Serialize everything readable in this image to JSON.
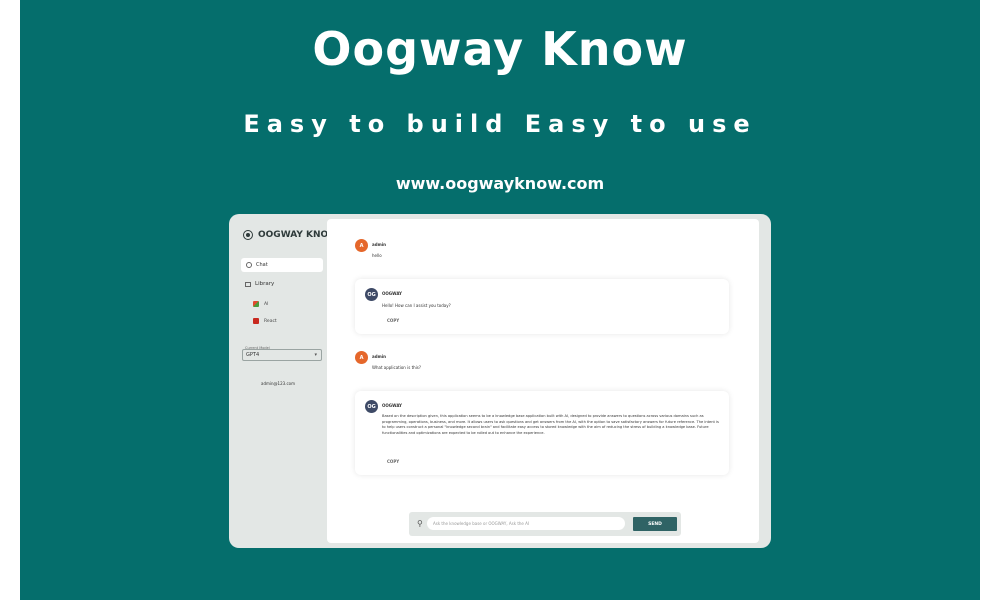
{
  "hero": {
    "title": "Oogway Know",
    "tagline": "Easy to build Easy to use",
    "url": "www.oogwayknow.com"
  },
  "app": {
    "sidebar": {
      "brand": "OOGWAY KNOW",
      "nav_chat": "Chat",
      "nav_library": "Library",
      "library_items": [
        "AI",
        "React"
      ],
      "model_label": "Current Model",
      "model_value": "GPT4",
      "user_email": "admin@123.com"
    },
    "chat": {
      "messages": [
        {
          "role": "user",
          "avatar": "A",
          "sender": "admin",
          "text": "hello"
        },
        {
          "role": "bot",
          "avatar": "OG",
          "sender": "OOGWAY",
          "text": "Hello! How can I assist you today?",
          "copy": "COPY"
        },
        {
          "role": "user",
          "avatar": "A",
          "sender": "admin",
          "text": "What application is this?"
        },
        {
          "role": "bot",
          "avatar": "OG",
          "sender": "OOGWAY",
          "text": "Based on the description given, this application seems to be a knowledge base application built with AI, designed to provide answers to questions across various domains such as programming, operations, business, and more. It allows users to ask questions and get answers from the AI, with the option to save satisfactory answers for future reference. The intent is to help users construct a personal \"knowledge second brain\" and facilitate easy access to stored knowledge with the aim of reducing the stress of building a knowledge base. Future functionalities and optimizations are expected to be rolled out to enhance the experience.",
          "copy": "COPY"
        }
      ],
      "input_placeholder": "Ask the knowledge base or OOGWAY, Ask the AI",
      "send_label": "SEND"
    }
  },
  "colors": {
    "banner": "#056e6c",
    "user_avatar": "#e5672b",
    "bot_avatar": "#3e4a66",
    "send_button": "#2f6365"
  }
}
